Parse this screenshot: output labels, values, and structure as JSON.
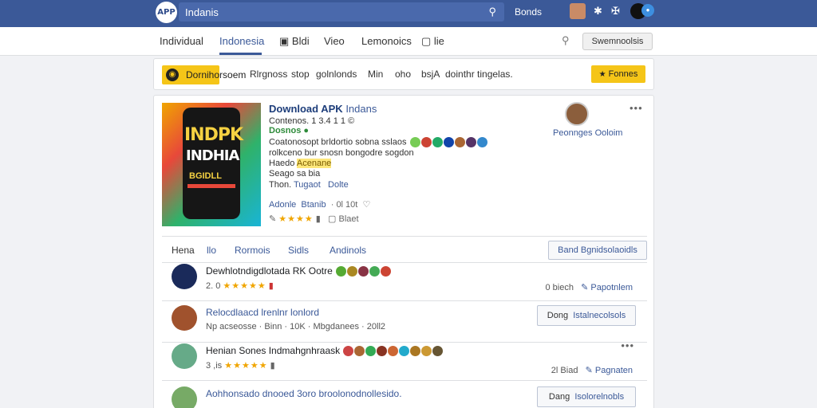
{
  "topbar": {
    "logo": "APP",
    "search_value": "Indanis",
    "user_name": "Bonds",
    "colors": {
      "bar": "#3b5998",
      "accent": "#f5c518"
    }
  },
  "nav": {
    "tabs": [
      "Individual",
      "Indonesia",
      "Bldi",
      "Vieo",
      "Lemonoics",
      "lie"
    ],
    "active_tab": "Indonesia",
    "right_button": "Swemnoolsis"
  },
  "promo": {
    "pill_label": "Dornihorsoem",
    "texts": [
      "Rlrgnoss",
      "stop",
      "golnlonds",
      "Min",
      "oho",
      "bsjA",
      "dointhr tingelas."
    ],
    "button_label": "Fonnes"
  },
  "app": {
    "cover": {
      "line1": "INDPK",
      "line2": "INDHIA",
      "line3": "BGIDLL",
      "line4": ""
    },
    "title": "Download APK",
    "title_sub": "Indans",
    "meta1": "Contenos. 1 3.4 1 1 ©",
    "meta2": "Dosnos ●",
    "desc1": "Coatonosopt brldortio sobna sslaos",
    "desc2": "rolkceno bur snosn bongodre sogdon",
    "desc3_prefix": "Haedo",
    "desc3_hl": "Acenane",
    "desc4": "Seago sa bia",
    "desc5_prefix": "Thon.",
    "desc5_link1": "Tugaot",
    "desc5_link2": "Dolte",
    "link_row_link": "Adonle",
    "link_row_link2": "Btanib",
    "link_row_count": "· 0l 10t",
    "rating_text": "Blaet",
    "author_name": "Peonnges Ooloim"
  },
  "subtabs": {
    "items": [
      "Hena",
      "llo",
      "Rormois",
      "Sidls",
      "Andinols"
    ],
    "button": "Band Bgnidsolaoidls"
  },
  "rows": [
    {
      "title": "Dewhlotndigdlotada RK Ootre",
      "meta_count": "2. 0",
      "side_count": "0 biech",
      "side_link": "Papotnlem",
      "button": ""
    },
    {
      "title": "Relocdlaacd lrenlnr lonlord",
      "meta": "Np acseosse · Binn · 10K · Mbgdanees · 20ll2",
      "side_count": "",
      "side_link": "",
      "button_prefix": "Dong",
      "button_link": "Istalnecolsols"
    },
    {
      "title": "Henian Sones Indmahgnhraask",
      "meta_count": "3 ,is",
      "side_count": "2l Biad",
      "side_link": "Pagnaten",
      "button": ""
    },
    {
      "title": "Aohhonsado dnooed 3oro broolonodnollesido.",
      "meta": "",
      "side_count": "",
      "side_link": "",
      "button_prefix": "Dang",
      "button_link": "Isolorelnobls"
    }
  ],
  "icons": [
    "search-icon",
    "settings-icon",
    "puzzle-icon",
    "heart-icon",
    "more-icon",
    "star-icon",
    "bookmark-icon",
    "link-icon"
  ]
}
